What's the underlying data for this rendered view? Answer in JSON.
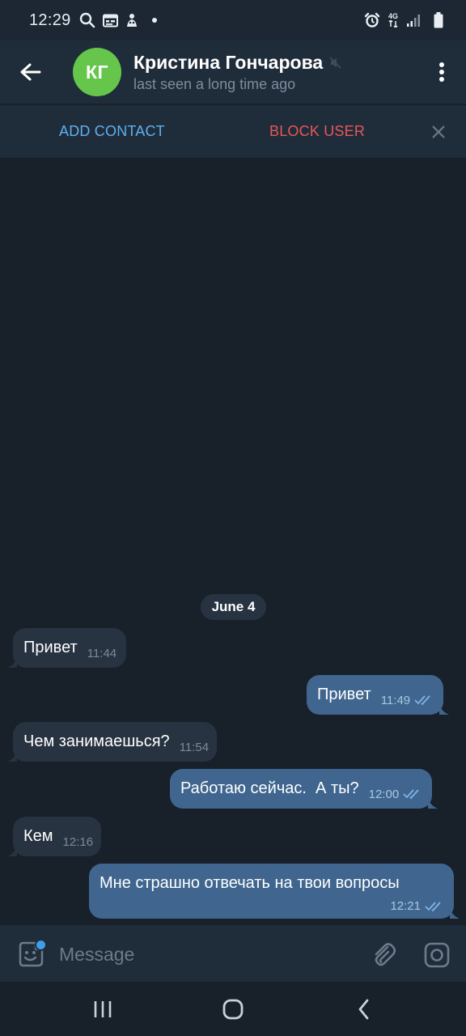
{
  "status_bar": {
    "time": "12:29",
    "left_icons": [
      "search-icon",
      "calendar-icon",
      "app-icon",
      "dot-icon"
    ],
    "right_icons": [
      "alarm-icon",
      "4g-icon",
      "signal-icon",
      "battery-icon"
    ],
    "network_label": "4G"
  },
  "header": {
    "avatar_initials": "КГ",
    "avatar_color": "#66c64b",
    "name": "Кристина Гончарова",
    "muted": true,
    "status": "last seen a long time ago"
  },
  "action_bar": {
    "add_contact": "ADD CONTACT",
    "block_user": "BLOCK USER"
  },
  "chat": {
    "date": "June 4",
    "messages": [
      {
        "direction": "in",
        "text": "Привет",
        "time": "11:44"
      },
      {
        "direction": "out",
        "text": "Привет",
        "time": "11:49",
        "read": true
      },
      {
        "direction": "in",
        "text": "Чем занимаешься?",
        "time": "11:54"
      },
      {
        "direction": "out",
        "text": "Работаю сейчас.  А ты?",
        "time": "12:00",
        "read": true
      },
      {
        "direction": "in",
        "text": "Кем",
        "time": "12:16"
      },
      {
        "direction": "out",
        "text": "Мне страшно отвечать на твои вопросы",
        "time": "12:21",
        "read": true
      }
    ]
  },
  "input_bar": {
    "placeholder": "Message"
  },
  "colors": {
    "background": "#18202a",
    "header": "#1f2c3a",
    "incoming_bubble": "#273341",
    "outgoing_bubble": "#40668f",
    "accent_blue": "#5fb0f1",
    "danger_red": "#e9575a"
  }
}
